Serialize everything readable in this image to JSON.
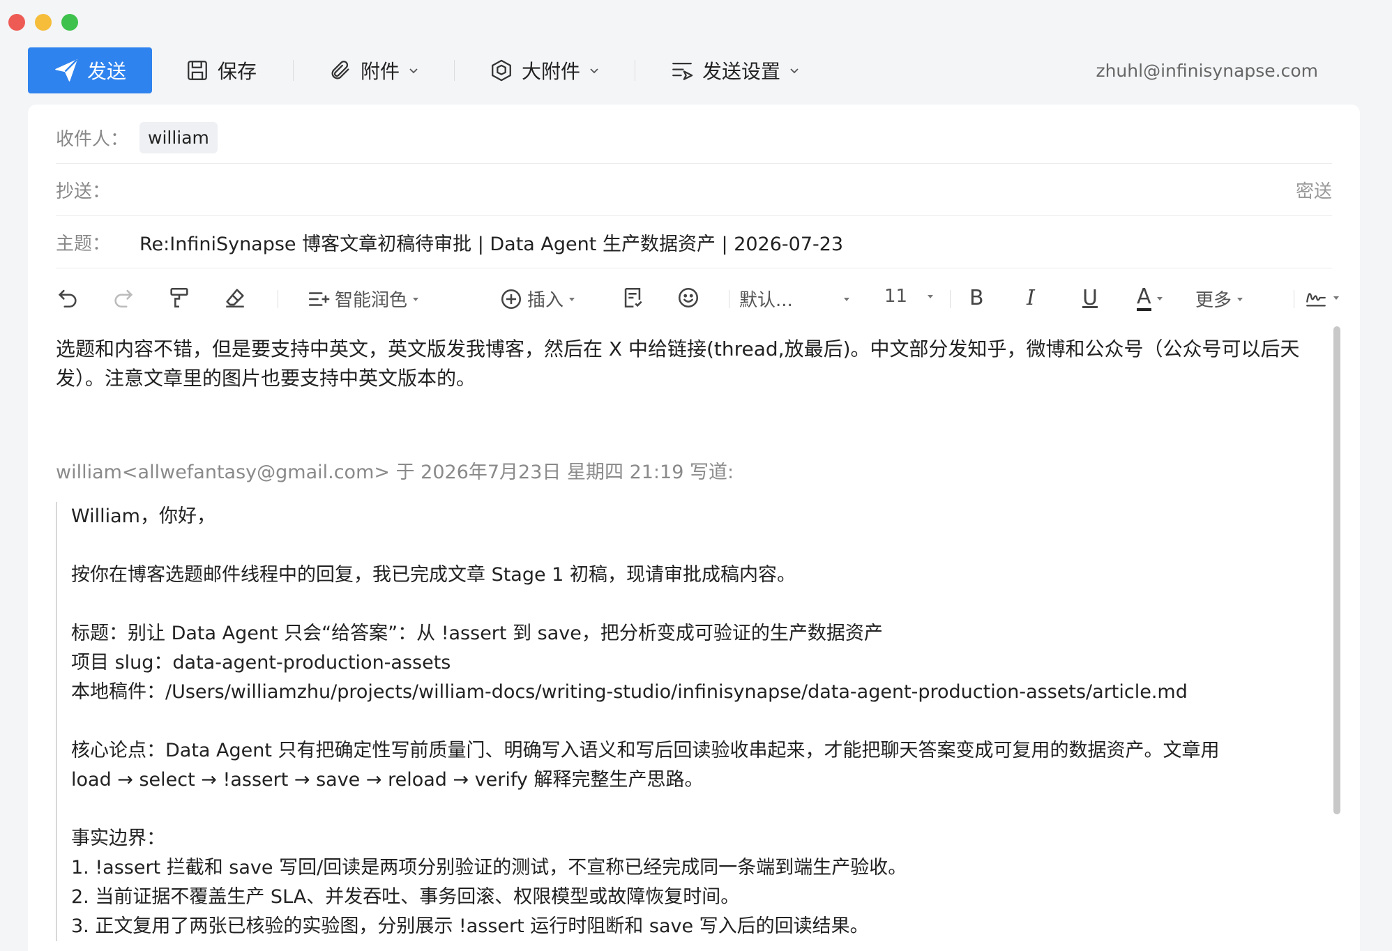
{
  "toolbar": {
    "send_label": "发送",
    "save_label": "保存",
    "attach_label": "附件",
    "large_attach_label": "大附件",
    "send_settings_label": "发送设置",
    "account": "zhuhl@infinisynapse.com"
  },
  "header": {
    "to_label": "收件人：",
    "to_chip": "william",
    "cc_label": "抄送：",
    "bcc_label": "密送",
    "subject_label": "主题：",
    "subject": "Re:InfiniSynapse 博客文章初稿待审批 | Data Agent 生产数据资产 | 2026-07-23"
  },
  "editor_toolbar": {
    "smart_polish": "智能润色",
    "insert": "插入",
    "font": "默认...",
    "font_size": "11",
    "bold": "B",
    "italic": "I",
    "underline": "U",
    "font_color": "A",
    "more": "更多"
  },
  "body": {
    "reply": "选题和内容不错，但是要支持中英文，英文版发我博客，然后在 X 中给链接(thread,放最后)。中文部分发知乎，微博和公众号（公众号可以后天发）。注意文章里的图片也要支持中英文版本的。",
    "quote_header": "william<allwefantasy@gmail.com> 于 2026年7月23日 星期四 21:19 写道:",
    "quote": {
      "greeting": "William，你好，",
      "intro": "按你在博客选题邮件线程中的回复，我已完成文章 Stage 1 初稿，现请审批成稿内容。",
      "title_line": "标题：别让 Data Agent 只会“给答案”：从 !assert 到 save，把分析变成可验证的生产数据资产",
      "slug_line": "项目 slug：data-agent-production-assets",
      "path_line": "本地稿件：/Users/williamzhu/projects/william-docs/writing-studio/infinisynapse/data-agent-production-assets/article.md",
      "core_line1": "核心论点：Data Agent 只有把确定性写前质量门、明确写入语义和写后回读验收串起来，才能把聊天答案变成可复用的数据资产。文章用",
      "core_line2": "load → select → !assert → save → reload → verify 解释完整生产思路。",
      "facts_heading": "事实边界：",
      "fact1": "1. !assert 拦截和 save 写回/回读是两项分别验证的测试，不宣称已经完成同一条端到端生产验收。",
      "fact2": "2. 当前证据不覆盖生产 SLA、并发吞吐、事务回滚、权限模型或故障恢复时间。",
      "fact3": "3. 正文复用了两张已核验的实验图，分别展示 !assert 运行时阻断和 save 写入后的回读结果。"
    }
  },
  "colors": {
    "accent": "#2f83ee",
    "label_gray": "#888888"
  }
}
